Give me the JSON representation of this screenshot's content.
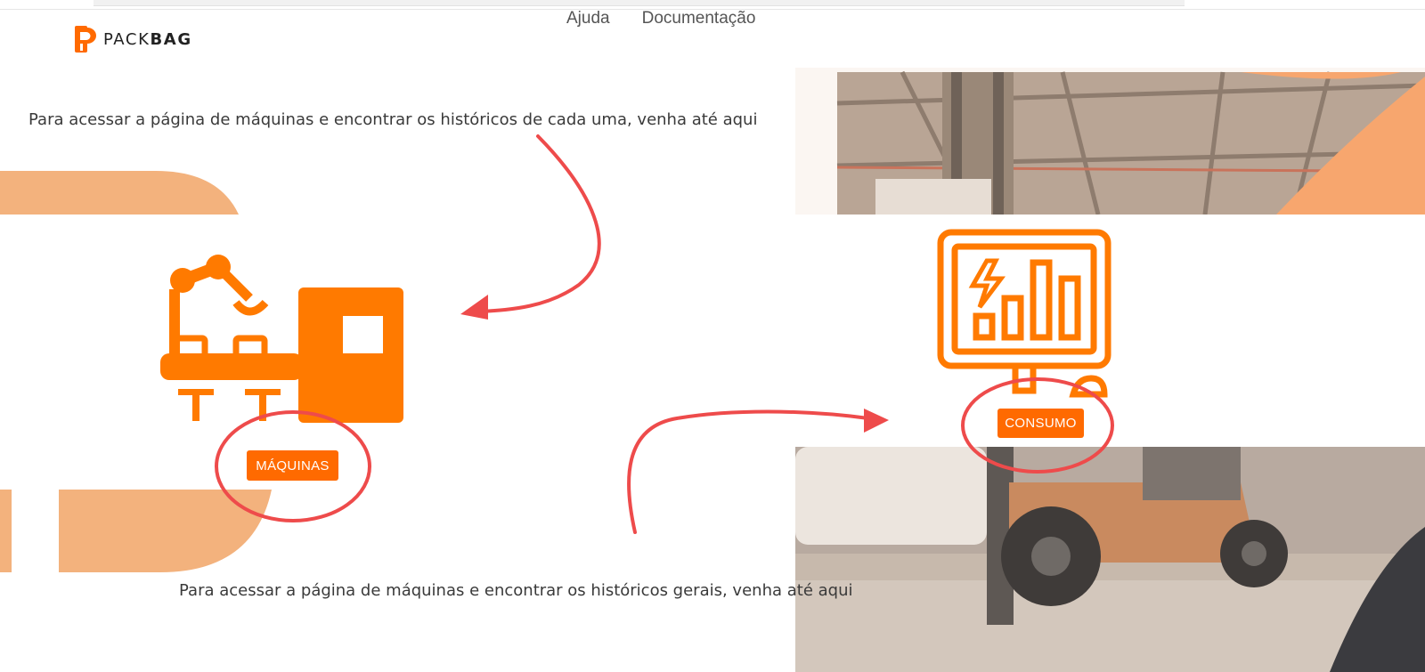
{
  "brand": {
    "logo_light": "PACK",
    "logo_bold": "BAG"
  },
  "nav": {
    "items": [
      "Ajuda",
      "Documentação"
    ]
  },
  "instructions": {
    "maquinas": "Para acessar a página de máquinas e encontrar os históricos de cada uma, venha até aqui",
    "consumo": "Para acessar a página de máquinas e encontrar os históricos gerais, venha até aqui"
  },
  "buttons": {
    "maquinas": "MÁQUINAS",
    "consumo": "CONSUMO"
  },
  "colors": {
    "brand_orange": "#ff6a00",
    "icon_orange": "#ff7a00",
    "deco_peach": "#f3b27d",
    "annotation_red": "#ee4b4b"
  },
  "icons": {
    "machine": "robotic-arm-factory-icon",
    "monitor": "energy-consumption-monitor-icon"
  }
}
